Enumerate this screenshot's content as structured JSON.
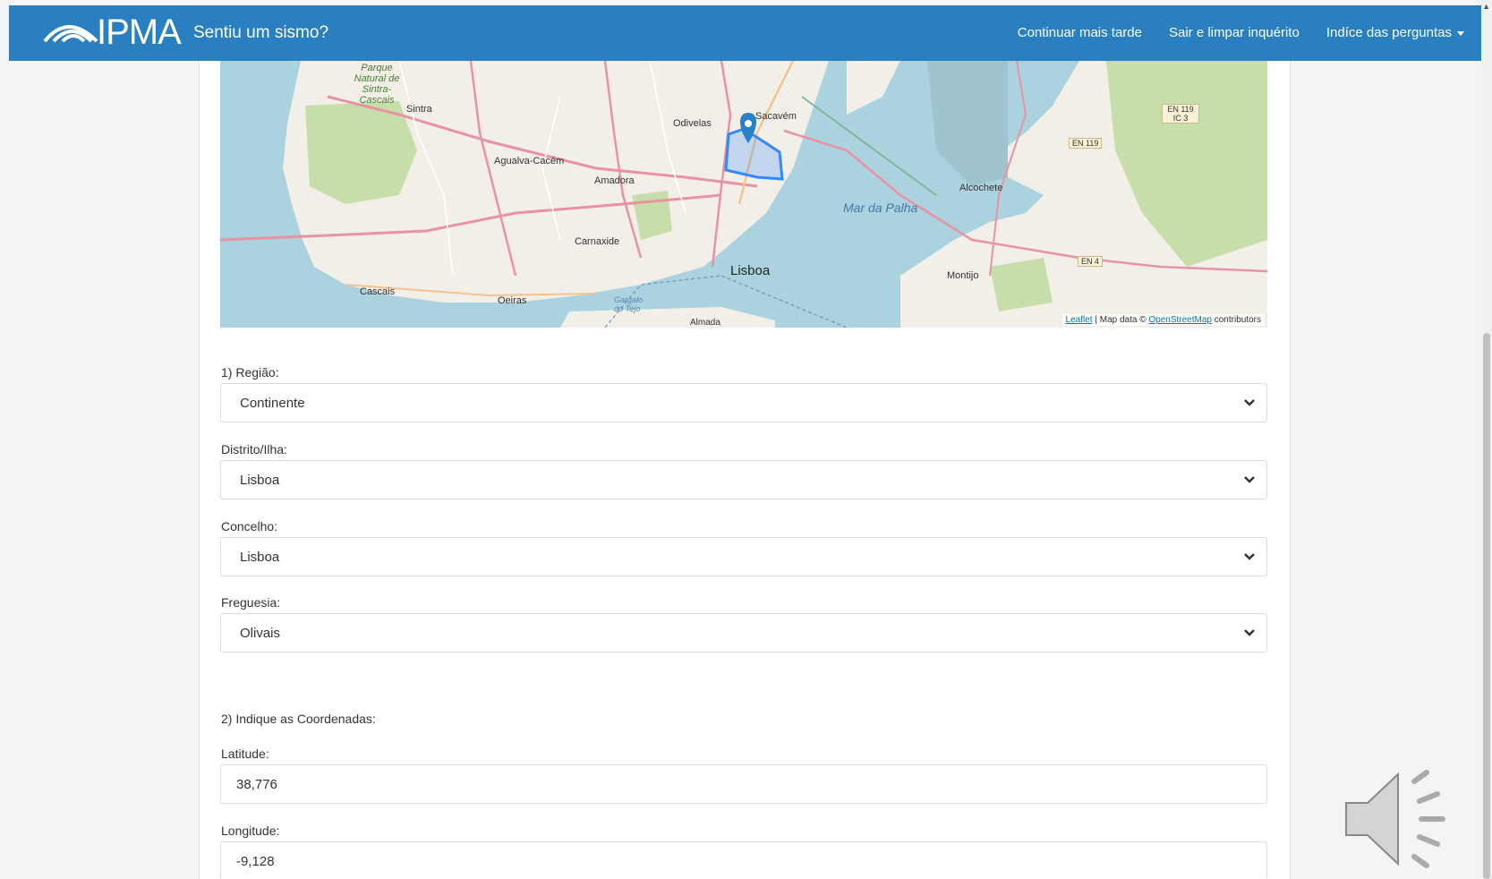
{
  "header": {
    "logo_text": "IPMA",
    "subtitle": "Sentiu um sismo?",
    "nav": {
      "continue_later": "Continuar mais tarde",
      "exit_clear": "Sair e limpar inquérito",
      "questions_index": "Indíce das perguntas"
    }
  },
  "map": {
    "labels": {
      "park": "Parque Natural de Sintra-Cascais",
      "sintra": "Sintra",
      "odivelas": "Odivelas",
      "sacavem": "Sacavém",
      "agualva": "Agualva-Cacém",
      "amadora": "Amadora",
      "carnaxide": "Carnaxide",
      "lisboa": "Lisboa",
      "cascais": "Cascais",
      "oeiras": "Oeiras",
      "alcochete": "Alcochete",
      "mar_da_palha": "Mar da Palha",
      "montijo": "Montijo",
      "en119": "EN 119",
      "en119_ic3": "EN 119 IC 3",
      "en4": "EN 4",
      "almada": "Almada",
      "gargalo": "Gargalo do Tejo"
    },
    "attribution": {
      "leaflet": "Leaflet",
      "map_data": "| Map data ©",
      "osm": "OpenStreetMap",
      "contributors": "contributors"
    }
  },
  "form": {
    "q1_label": "1) Região:",
    "region_value": "Continente",
    "district_label": "Distrito/Ilha:",
    "district_value": "Lisboa",
    "municipality_label": "Concelho:",
    "municipality_value": "Lisboa",
    "parish_label": "Freguesia:",
    "parish_value": "Olivais",
    "q2_label": "2) Indique as Coordenadas:",
    "latitude_label": "Latitude:",
    "latitude_value": "38,776",
    "longitude_label": "Longitude:",
    "longitude_value": "-9,128"
  },
  "colors": {
    "navbar": "#2a7fc0",
    "water": "#aad3df",
    "land": "#f2efe9",
    "park": "#c8deaa",
    "marker": "#2a81cb"
  }
}
